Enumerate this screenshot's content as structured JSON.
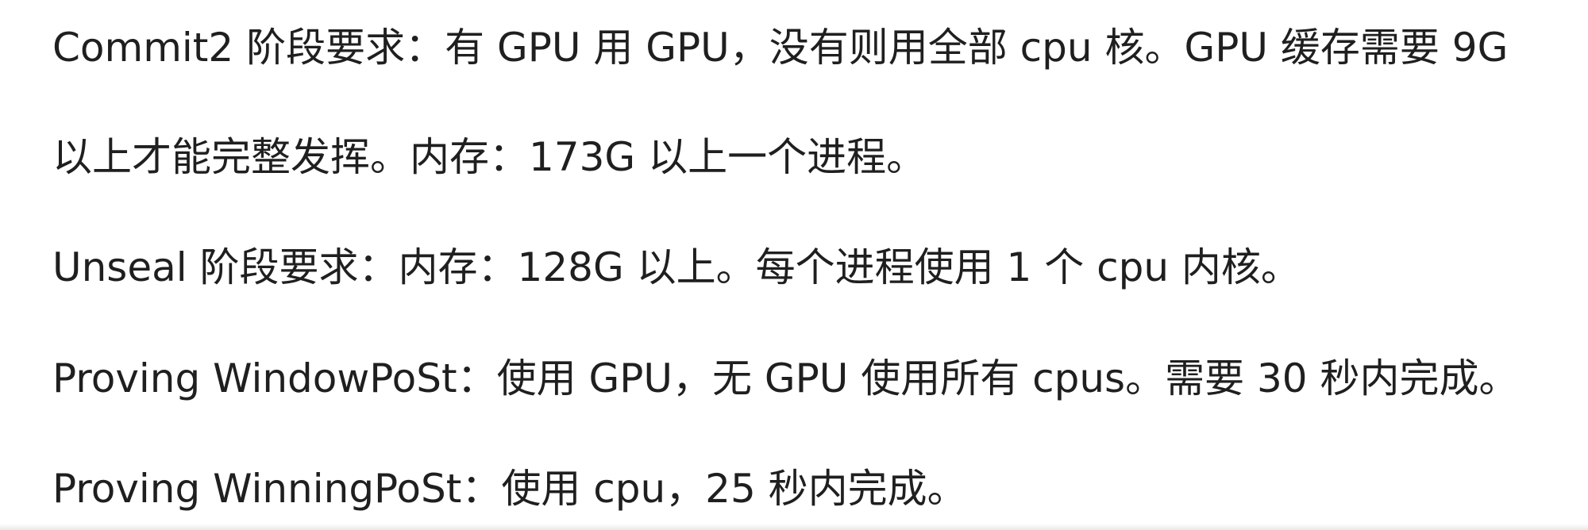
{
  "document": {
    "lines": [
      "Commit2 阶段要求：有 GPU 用 GPU，没有则用全部 cpu 核。GPU 缓存需要 9G",
      "以上才能完整发挥。内存：173G 以上一个进程。",
      "Unseal 阶段要求：内存：128G 以上。每个进程使用 1 个 cpu 内核。",
      "Proving WindowPoSt：使用 GPU，无 GPU 使用所有 cpus。需要 30 秒内完成。",
      "Proving WinningPoSt：使用 cpu，25 秒内完成。"
    ]
  },
  "colors": {
    "text": "#1f1f1f",
    "background": "#ffffff"
  }
}
